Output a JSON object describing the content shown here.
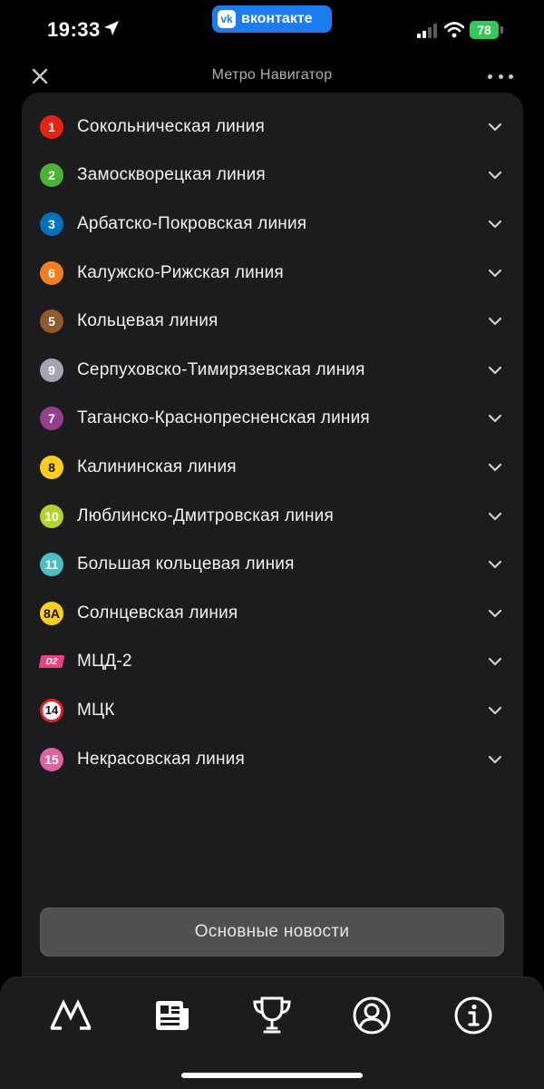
{
  "status_bar": {
    "time": "19:33",
    "vk_logo": "vk",
    "vk_label": "вконтакте",
    "battery": "78"
  },
  "header": {
    "title": "Метро Навигатор",
    "close_icon": "close-icon",
    "more_icon": "more-horizontal-icon"
  },
  "lines": [
    {
      "badge": "1",
      "name": "Сокольническая линия",
      "color": "#e42313",
      "style": "circle"
    },
    {
      "badge": "2",
      "name": "Замоскворецкая линия",
      "color": "#4bb139",
      "style": "circle"
    },
    {
      "badge": "3",
      "name": "Арбатско-Покровская линия",
      "color": "#0072ba",
      "style": "circle"
    },
    {
      "badge": "6",
      "name": "Калужско-Рижская линия",
      "color": "#f07e24",
      "style": "circle"
    },
    {
      "badge": "5",
      "name": "Кольцевая линия",
      "color": "#8d5b2d",
      "style": "circle"
    },
    {
      "badge": "9",
      "name": "Серпуховско-Тимирязевская линия",
      "color": "#a2a5b4",
      "style": "circle"
    },
    {
      "badge": "7",
      "name": "Таганско-Краснопресненская линия",
      "color": "#943e90",
      "style": "circle"
    },
    {
      "badge": "8",
      "name": "Калининская линия",
      "color": "#ffcd1c",
      "style": "circle-dark"
    },
    {
      "badge": "10",
      "name": "Люблинско-Дмитровская линия",
      "color": "#b1d332",
      "style": "circle"
    },
    {
      "badge": "11",
      "name": "Большая кольцевая линия",
      "color": "#48c0c2",
      "style": "circle"
    },
    {
      "badge": "8А",
      "name": "Солнцевская линия",
      "color": "#ffcd1c",
      "style": "circle-dark"
    },
    {
      "badge": "D2",
      "name": "МЦД-2",
      "color": "#e94282",
      "style": "rect"
    },
    {
      "badge": "14",
      "name": "МЦК",
      "color": "#ffffff",
      "style": "outline"
    },
    {
      "badge": "15",
      "name": "Некрасовская линия",
      "color": "#de64a1",
      "style": "circle"
    }
  ],
  "news_button": "Основные новости",
  "tabs": [
    {
      "name": "metro-icon"
    },
    {
      "name": "news-icon"
    },
    {
      "name": "trophy-icon"
    },
    {
      "name": "profile-icon"
    },
    {
      "name": "info-icon"
    }
  ]
}
